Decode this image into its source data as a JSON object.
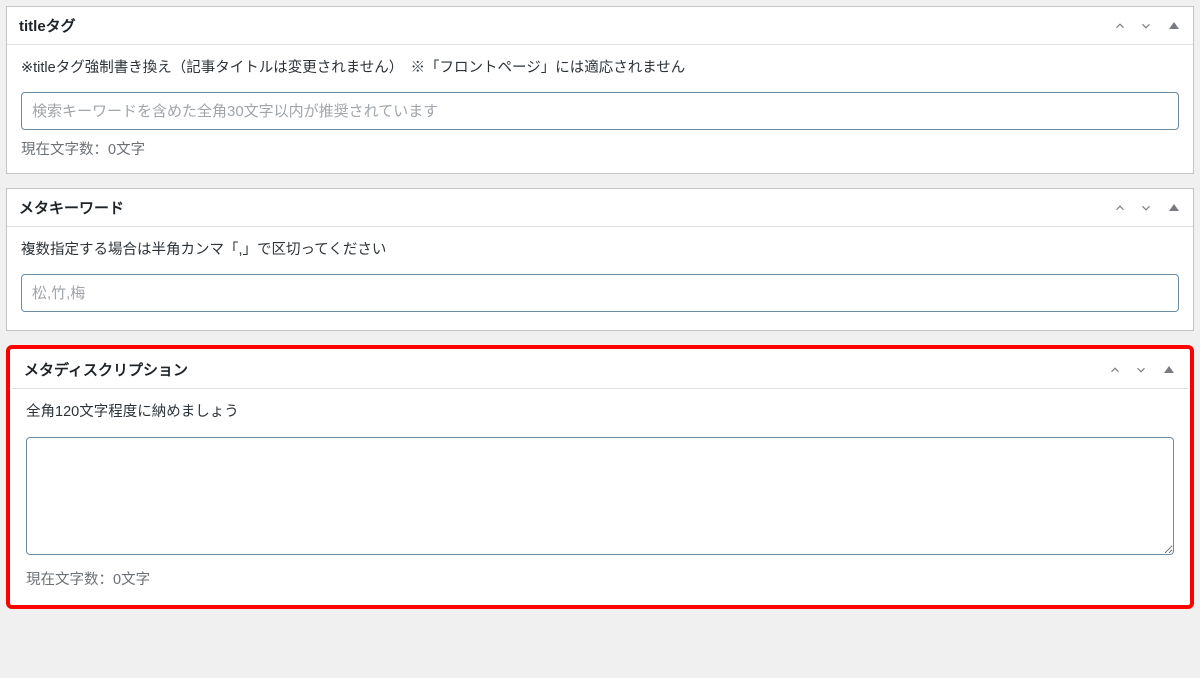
{
  "sections": {
    "title_tag": {
      "heading": "titleタグ",
      "help": "※titleタグ強制書き換え（記事タイトルは変更されません）　※「フロントページ」には適応されません",
      "placeholder": "検索キーワードを含めた全角30文字以内が推奨されています",
      "value": "",
      "char_count": "現在文字数：0文字"
    },
    "meta_keywords": {
      "heading": "メタキーワード",
      "help": "複数指定する場合は半角カンマ「,」で区切ってください",
      "placeholder": "松,竹,梅",
      "value": ""
    },
    "meta_description": {
      "heading": "メタディスクリプション",
      "help": "全角120文字程度に納めましょう",
      "value": "",
      "char_count": "現在文字数：0文字"
    }
  }
}
